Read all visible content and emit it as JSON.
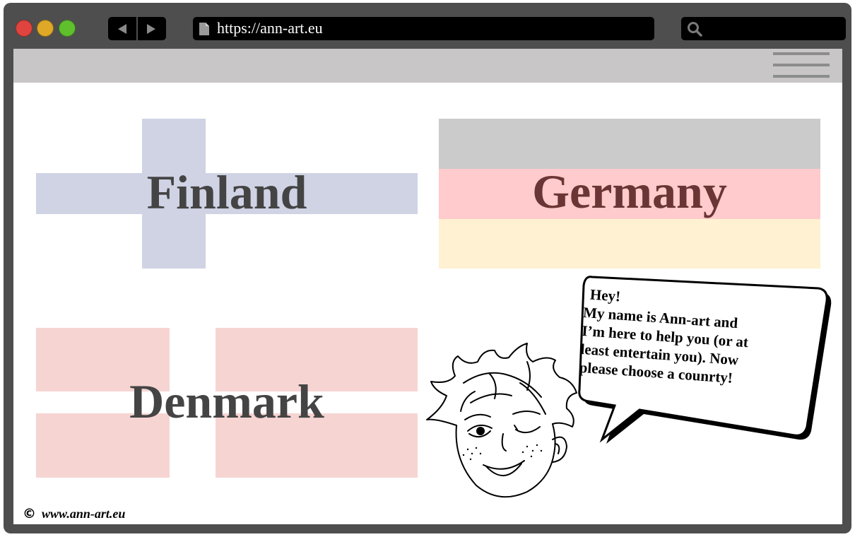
{
  "browser": {
    "url": "https://ann-art.eu",
    "nav": {
      "back_icon": "triangle-left",
      "forward_icon": "triangle-right"
    },
    "search_icon": "magnifier",
    "traffic_lights": {
      "close": "#e0443e",
      "minimize": "#dfa826",
      "maximize": "#5fbf2d"
    }
  },
  "header": {
    "menu_icon": "hamburger"
  },
  "flags": [
    {
      "country": "Finland",
      "colors": [
        "#cfd3e4"
      ]
    },
    {
      "country": "Germany",
      "colors": [
        "#cbcbcb",
        "#ffcbcc",
        "#fff1d2"
      ]
    },
    {
      "country": "Denmark",
      "colors": [
        "#f6d4d2"
      ]
    }
  ],
  "bubble": {
    "lines": [
      "Hey!",
      "My name is Ann-art and",
      "I’m here to help you (or at",
      "least entertain you). Now",
      "please choose a counrty!"
    ]
  },
  "footer": {
    "copyright": "©",
    "site": "www.ann-art.eu"
  }
}
